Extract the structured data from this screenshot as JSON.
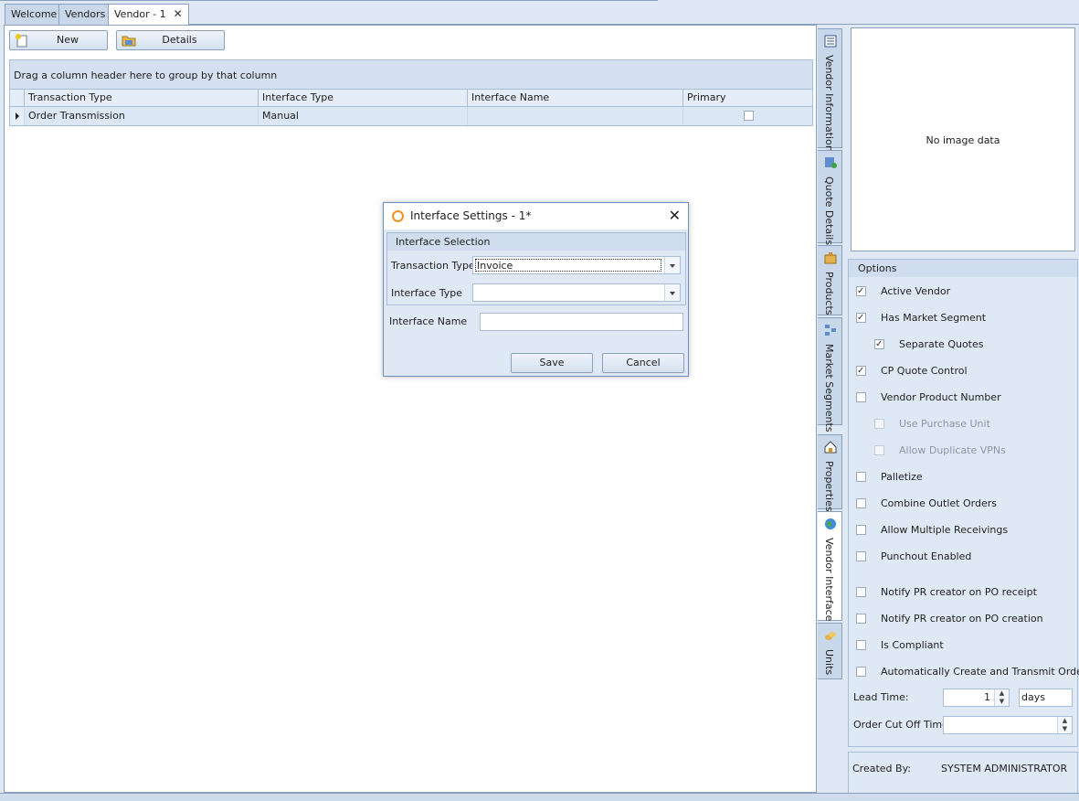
{
  "tabs": [
    {
      "label": "Welcome"
    },
    {
      "label": "Vendors"
    },
    {
      "label": "Vendor - 1"
    }
  ],
  "toolbar": {
    "new_label": "New",
    "details_label": "Details"
  },
  "grid": {
    "group_hint": "Drag a column header here to group by that column",
    "columns": [
      "Transaction Type",
      "Interface Type",
      "Interface Name",
      "Primary"
    ],
    "rows": [
      {
        "transaction_type": "Order Transmission",
        "interface_type": "Manual",
        "interface_name": "",
        "primary": false
      }
    ]
  },
  "dialog": {
    "title": "Interface Settings - 1*",
    "group_title": "Interface Selection",
    "transaction_type_label": "Transaction Type",
    "transaction_type_value": "Invoice",
    "interface_type_label": "Interface Type",
    "interface_type_value": "",
    "interface_name_label": "Interface Name",
    "interface_name_value": "",
    "save_label": "Save",
    "cancel_label": "Cancel"
  },
  "side_tabs": [
    {
      "label": "Vendor Information",
      "icon": "vendor-info-icon"
    },
    {
      "label": "Quote Details",
      "icon": "quote-details-icon"
    },
    {
      "label": "Products",
      "icon": "products-icon"
    },
    {
      "label": "Market Segments",
      "icon": "market-segments-icon"
    },
    {
      "label": "Properties",
      "icon": "properties-icon"
    },
    {
      "label": "Vendor Interface",
      "icon": "vendor-interface-icon"
    },
    {
      "label": "Units",
      "icon": "units-icon"
    }
  ],
  "image_box": {
    "message": "No image data"
  },
  "options": {
    "title": "Options",
    "items": [
      {
        "label": "Active Vendor",
        "checked": true,
        "enabled": true
      },
      {
        "label": "Has Market Segment",
        "checked": true,
        "enabled": true
      },
      {
        "label": "Separate Quotes",
        "checked": true,
        "enabled": true
      },
      {
        "label": "CP Quote Control",
        "checked": true,
        "enabled": true
      },
      {
        "label": "Vendor Product Number",
        "checked": false,
        "enabled": true
      },
      {
        "label": "Use Purchase Unit",
        "checked": false,
        "enabled": false
      },
      {
        "label": "Allow Duplicate VPNs",
        "checked": false,
        "enabled": false
      },
      {
        "label": "Palletize",
        "checked": false,
        "enabled": true
      },
      {
        "label": "Combine Outlet Orders",
        "checked": false,
        "enabled": true
      },
      {
        "label": "Allow Multiple Receivings",
        "checked": false,
        "enabled": true
      },
      {
        "label": "Punchout Enabled",
        "checked": false,
        "enabled": true
      },
      {
        "label": "Notify PR creator on PO receipt",
        "checked": false,
        "enabled": true
      },
      {
        "label": "Notify PR creator on PO creation",
        "checked": false,
        "enabled": true
      },
      {
        "label": "Is Compliant",
        "checked": false,
        "enabled": true
      },
      {
        "label": "Automatically Create and Transmit Orders",
        "checked": false,
        "enabled": true
      }
    ],
    "lead_time_label": "Lead Time:",
    "lead_time_value": "1",
    "lead_time_unit": "days",
    "cutoff_label": "Order Cut Off Time",
    "cutoff_value": ""
  },
  "created": {
    "label": "Created By:",
    "value": "SYSTEM ADMINISTRATOR"
  }
}
